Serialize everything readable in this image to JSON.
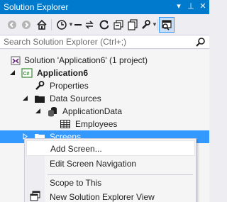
{
  "window": {
    "title": "Solution Explorer",
    "buttons": [
      "▾",
      "⊥",
      "✕"
    ]
  },
  "search": {
    "placeholder": "Search Solution Explorer (Ctrl+;)"
  },
  "tree": {
    "nodes": [
      {
        "label": "Solution 'Application6' (1 project)",
        "icon": "solution-icon"
      },
      {
        "label": "Application6",
        "icon": "csharp-project-icon",
        "bold": true,
        "expanded": true
      },
      {
        "label": "Properties",
        "icon": "wrench-icon"
      },
      {
        "label": "Data Sources",
        "icon": "folder-icon",
        "expanded": true
      },
      {
        "label": "ApplicationData",
        "icon": "database-icon",
        "expanded": true
      },
      {
        "label": "Employees",
        "icon": "table-icon"
      },
      {
        "label": "Screens",
        "icon": "folder-icon",
        "selected": true
      }
    ]
  },
  "context_menu": {
    "items": [
      {
        "label": "Add Screen...",
        "hover": true
      },
      {
        "label": "Edit Screen Navigation"
      },
      {
        "label": "Scope to This"
      },
      {
        "label": "New Solution Explorer View",
        "icon": "new-view-icon"
      }
    ]
  },
  "colors": {
    "accent": "#007acc",
    "selection": "#3399ff",
    "background": "#eeeef2"
  }
}
